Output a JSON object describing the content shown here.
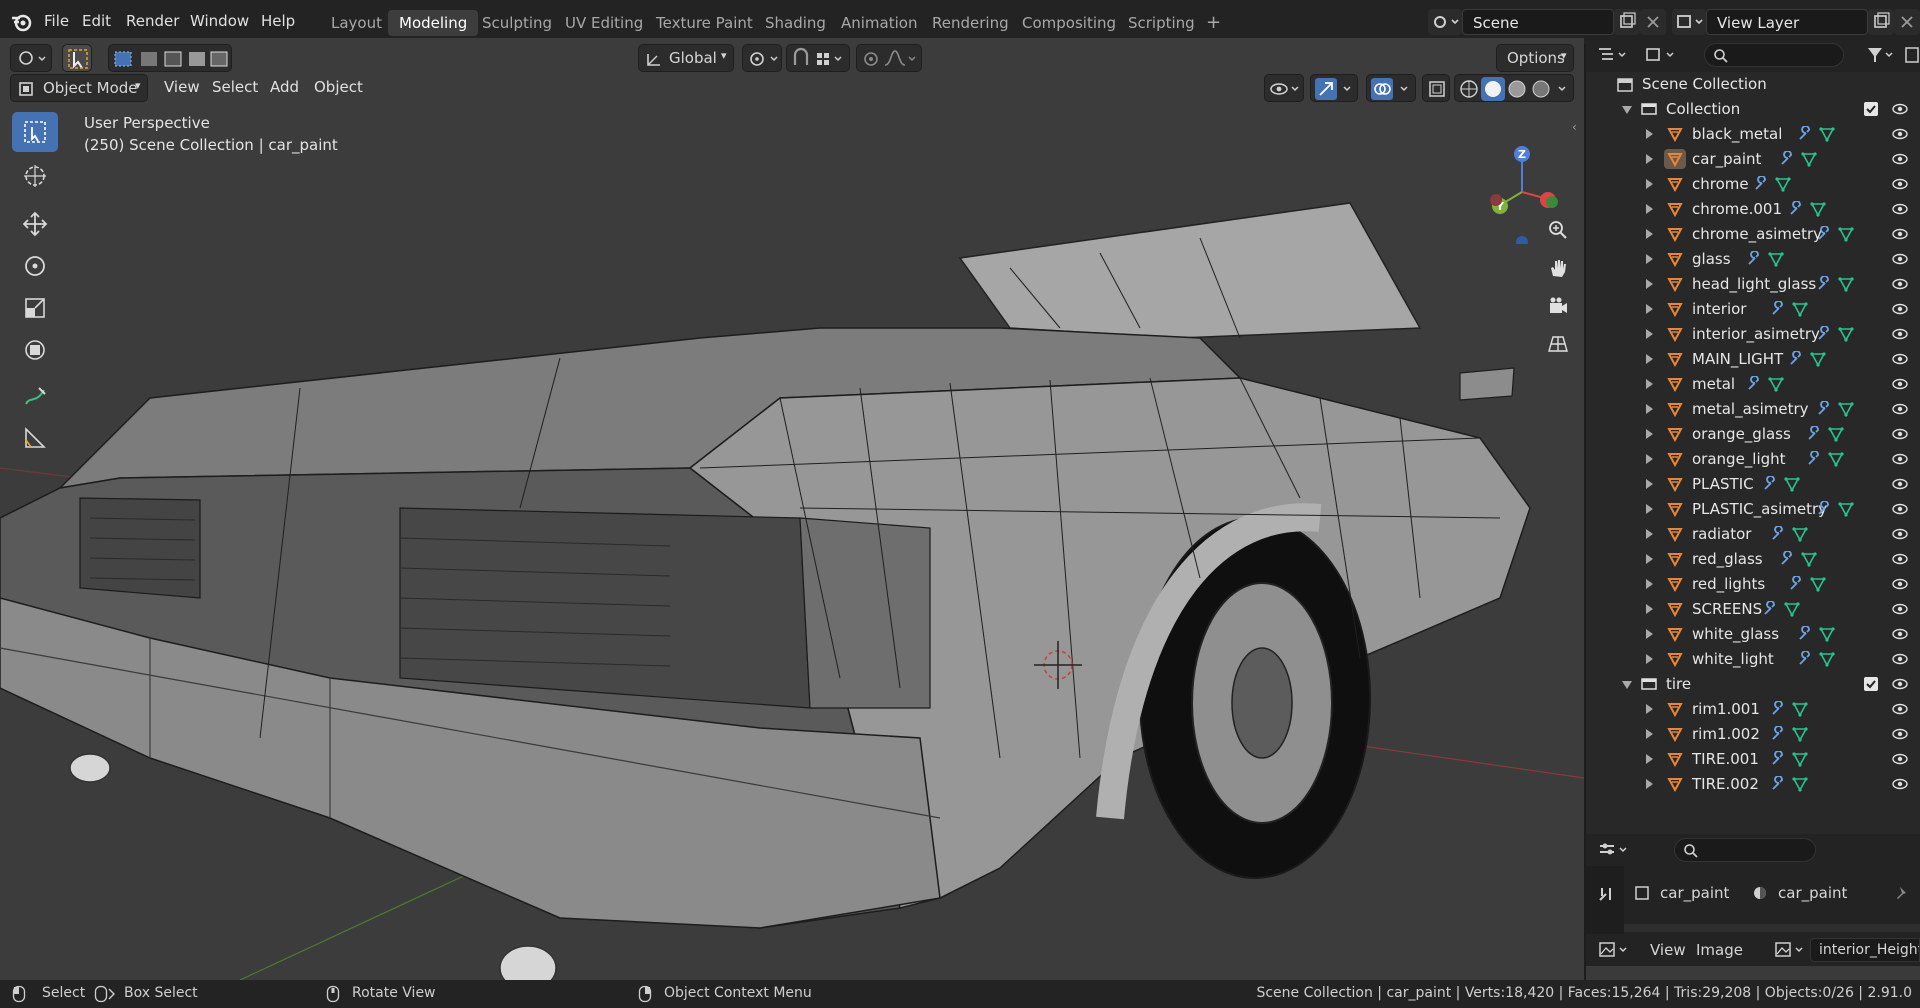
{
  "topbar": {
    "menus": [
      "File",
      "Edit",
      "Render",
      "Window",
      "Help"
    ],
    "workspaces": [
      "Layout",
      "Modeling",
      "Sculpting",
      "UV Editing",
      "Texture Paint",
      "Shading",
      "Animation",
      "Rendering",
      "Compositing",
      "Scripting"
    ],
    "active_workspace": "Modeling",
    "add_workspace": "+",
    "scene": "Scene",
    "view_layer": "View Layer"
  },
  "viewport": {
    "mode": "Object Mode",
    "menus": [
      "View",
      "Select",
      "Add",
      "Object"
    ],
    "orientation": "Global",
    "options": "Options",
    "overlay_line1": "User Perspective",
    "overlay_line2": "(250) Scene Collection | car_paint",
    "gizmo": {
      "z": "Z",
      "y": "Y"
    }
  },
  "outliner": {
    "scene_collection": "Scene Collection",
    "collections": [
      {
        "name": "Collection",
        "objects": [
          "black_metal",
          "car_paint",
          "chrome",
          "chrome.001",
          "chrome_asimetry",
          "glass",
          "head_light_glass",
          "interior",
          "interior_asimetry",
          "MAIN_LIGHT",
          "metal",
          "metal_asimetry",
          "orange_glass",
          "orange_light",
          "PLASTIC",
          "PLASTIC_asimetry",
          "radiator",
          "red_glass",
          "red_lights",
          "SCREENS",
          "white_glass",
          "white_light"
        ]
      },
      {
        "name": "tire",
        "objects": [
          "rim1.001",
          "rim1.002",
          "TIRE.001",
          "TIRE.002"
        ]
      }
    ],
    "active_object": "car_paint"
  },
  "properties": {
    "object_name": "car_paint",
    "material_name": "car_paint"
  },
  "image_editor": {
    "menus": [
      "View",
      "Image"
    ],
    "image_name": "interior_Height.p"
  },
  "statusbar": {
    "select": "Select",
    "box_select": "Box Select",
    "rotate_view": "Rotate View",
    "context_menu": "Object Context Menu",
    "stats": "Scene Collection | car_paint | Verts:18,420 | Faces:15,264 | Tris:29,208 | Objects:0/26 | 2.91.0"
  },
  "colors": {
    "accent": "#4472b3",
    "object_orange": "#e8873a",
    "modifier_blue": "#6ba4e8",
    "mesh_green": "#27c48e"
  }
}
